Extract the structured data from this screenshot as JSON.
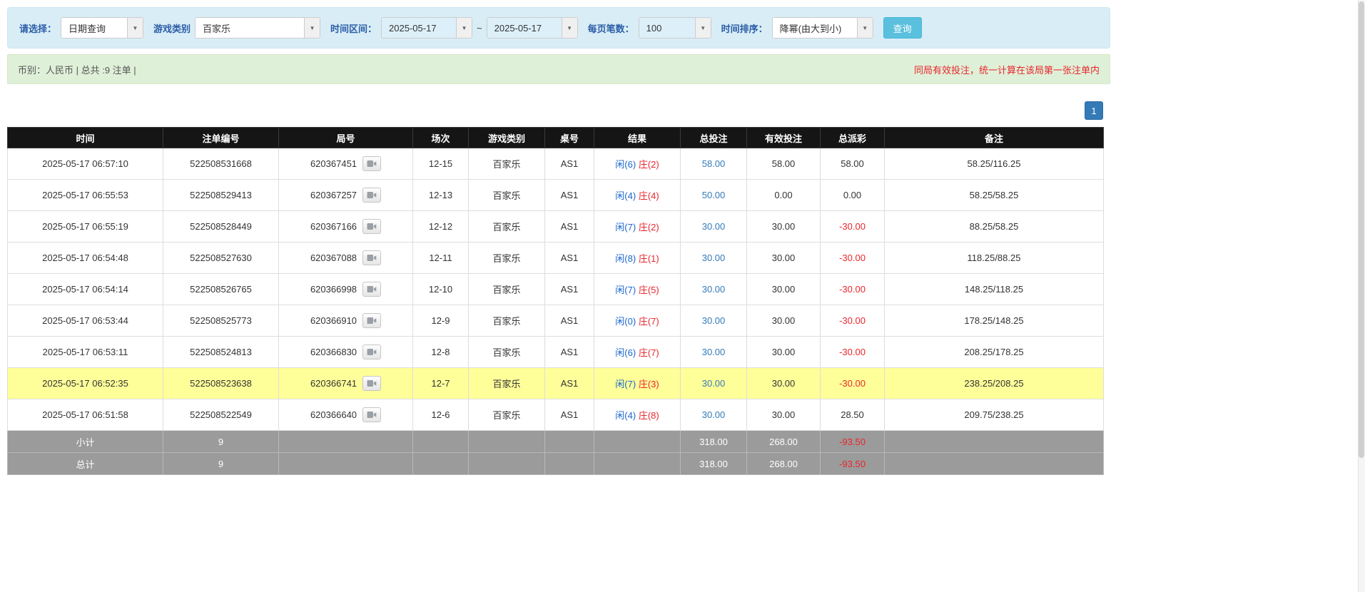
{
  "filter_bar": {
    "select_label": "请选择：",
    "select_value": "日期查询",
    "game_label": "游戏类别",
    "game_value": "百家乐",
    "time_range_label": "时间区间：",
    "date_from": "2025-05-17",
    "tilde": "~",
    "date_to": "2025-05-17",
    "per_page_label": "每页笔数：",
    "per_page_value": "100",
    "sort_label": "时间排序：",
    "sort_value": "降幂(由大到小)",
    "search_button_label": "查询"
  },
  "summary_bar": {
    "left_text": "币别：人民币 | 总共 :9 注单 |",
    "right_note": "同局有效投注，统一计算在该局第一张注单内"
  },
  "pagination": {
    "current_page": "1"
  },
  "table": {
    "headers": [
      "时间",
      "注单编号",
      "局号",
      "场次",
      "游戏类别",
      "桌号",
      "结果",
      "总投注",
      "有效投注",
      "总派彩",
      "备注"
    ],
    "rows": [
      {
        "time": "2025-05-17 06:57:10",
        "bet_id": "522508531668",
        "round_no": "620367451",
        "session": "12-15",
        "game": "百家乐",
        "table_no": "AS1",
        "player": "闲(6)",
        "banker": "庄(2)",
        "total_bet": "58.00",
        "valid_bet": "58.00",
        "payout": "58.00",
        "remark": "58.25/116.25",
        "highlight": false
      },
      {
        "time": "2025-05-17 06:55:53",
        "bet_id": "522508529413",
        "round_no": "620367257",
        "session": "12-13",
        "game": "百家乐",
        "table_no": "AS1",
        "player": "闲(4)",
        "banker": "庄(4)",
        "total_bet": "50.00",
        "valid_bet": "0.00",
        "payout": "0.00",
        "remark": "58.25/58.25",
        "highlight": false
      },
      {
        "time": "2025-05-17 06:55:19",
        "bet_id": "522508528449",
        "round_no": "620367166",
        "session": "12-12",
        "game": "百家乐",
        "table_no": "AS1",
        "player": "闲(7)",
        "banker": "庄(2)",
        "total_bet": "30.00",
        "valid_bet": "30.00",
        "payout": "-30.00",
        "remark": "88.25/58.25",
        "highlight": false
      },
      {
        "time": "2025-05-17 06:54:48",
        "bet_id": "522508527630",
        "round_no": "620367088",
        "session": "12-11",
        "game": "百家乐",
        "table_no": "AS1",
        "player": "闲(8)",
        "banker": "庄(1)",
        "total_bet": "30.00",
        "valid_bet": "30.00",
        "payout": "-30.00",
        "remark": "118.25/88.25",
        "highlight": false
      },
      {
        "time": "2025-05-17 06:54:14",
        "bet_id": "522508526765",
        "round_no": "620366998",
        "session": "12-10",
        "game": "百家乐",
        "table_no": "AS1",
        "player": "闲(7)",
        "banker": "庄(5)",
        "total_bet": "30.00",
        "valid_bet": "30.00",
        "payout": "-30.00",
        "remark": "148.25/118.25",
        "highlight": false
      },
      {
        "time": "2025-05-17 06:53:44",
        "bet_id": "522508525773",
        "round_no": "620366910",
        "session": "12-9",
        "game": "百家乐",
        "table_no": "AS1",
        "player": "闲(0)",
        "banker": "庄(7)",
        "total_bet": "30.00",
        "valid_bet": "30.00",
        "payout": "-30.00",
        "remark": "178.25/148.25",
        "highlight": false
      },
      {
        "time": "2025-05-17 06:53:11",
        "bet_id": "522508524813",
        "round_no": "620366830",
        "session": "12-8",
        "game": "百家乐",
        "table_no": "AS1",
        "player": "闲(6)",
        "banker": "庄(7)",
        "total_bet": "30.00",
        "valid_bet": "30.00",
        "payout": "-30.00",
        "remark": "208.25/178.25",
        "highlight": false
      },
      {
        "time": "2025-05-17 06:52:35",
        "bet_id": "522508523638",
        "round_no": "620366741",
        "session": "12-7",
        "game": "百家乐",
        "table_no": "AS1",
        "player": "闲(7)",
        "banker": "庄(3)",
        "total_bet": "30.00",
        "valid_bet": "30.00",
        "payout": "-30.00",
        "remark": "238.25/208.25",
        "highlight": true
      },
      {
        "time": "2025-05-17 06:51:58",
        "bet_id": "522508522549",
        "round_no": "620366640",
        "session": "12-6",
        "game": "百家乐",
        "table_no": "AS1",
        "player": "闲(4)",
        "banker": "庄(8)",
        "total_bet": "30.00",
        "valid_bet": "30.00",
        "payout": "28.50",
        "remark": "209.75/238.25",
        "highlight": false
      }
    ],
    "footer": [
      {
        "label": "小计",
        "count": "9",
        "total_bet": "318.00",
        "valid_bet": "268.00",
        "payout": "-93.50"
      },
      {
        "label": "总计",
        "count": "9",
        "total_bet": "318.00",
        "valid_bet": "268.00",
        "payout": "-93.50"
      }
    ]
  },
  "colors": {
    "filter_bar_bg": "#d9edf7",
    "summary_bar_bg": "#dff0d8",
    "header_bg": "#151515",
    "footer_bg": "#9b9b9b",
    "highlight_yellow": "#ffff99",
    "player_blue": "#1a66cc",
    "banker_red": "#e8262d",
    "negative_red": "#e8262d",
    "link_blue": "#337ab7",
    "query_button_cyan": "#5bc0de",
    "note_red": "#e8262d"
  }
}
